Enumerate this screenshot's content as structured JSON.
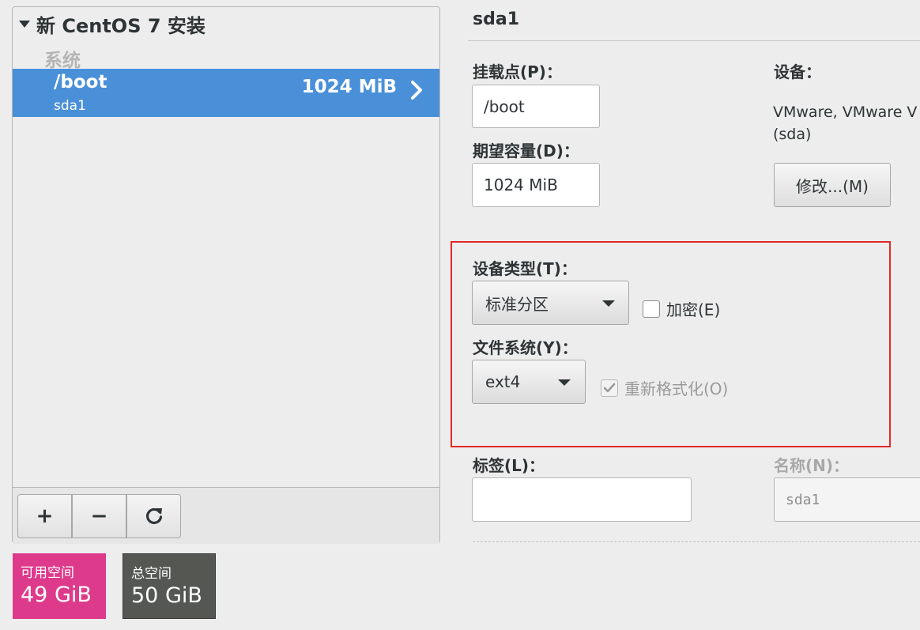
{
  "left": {
    "install_title": "新 CentOS 7 安装",
    "category": "系统",
    "mount": {
      "path": "/boot",
      "device": "sda1",
      "size": "1024 MiB"
    },
    "toolbar": {
      "add": "+",
      "remove": "−",
      "refresh": "⟳"
    }
  },
  "storage": {
    "available_label": "可用空间",
    "available_value": "49 GiB",
    "available_color": "#de3a8b",
    "total_label": "总空间",
    "total_value": "50 GiB",
    "total_color": "#555753"
  },
  "right": {
    "title": "sda1",
    "mount_point_label": "挂载点(P)：",
    "mount_point_value": "/boot",
    "capacity_label": "期望容量(D)：",
    "capacity_value": "1024 MiB",
    "device_label": "设备：",
    "device_line1": "VMware, VMware V",
    "device_line2": "(sda)",
    "modify_button": "修改...(M)",
    "device_type_label": "设备类型(T)：",
    "device_type_value": "标准分区",
    "encrypt_label": "加密(E)",
    "encrypt_checked": false,
    "filesystem_label": "文件系统(Y)：",
    "filesystem_value": "ext4",
    "reformat_label": "重新格式化(O)",
    "reformat_checked": true,
    "tag_label": "标签(L)：",
    "tag_value": "",
    "name_label": "名称(N)：",
    "name_value": "sda1",
    "highlight_color": "#e02a2a"
  }
}
